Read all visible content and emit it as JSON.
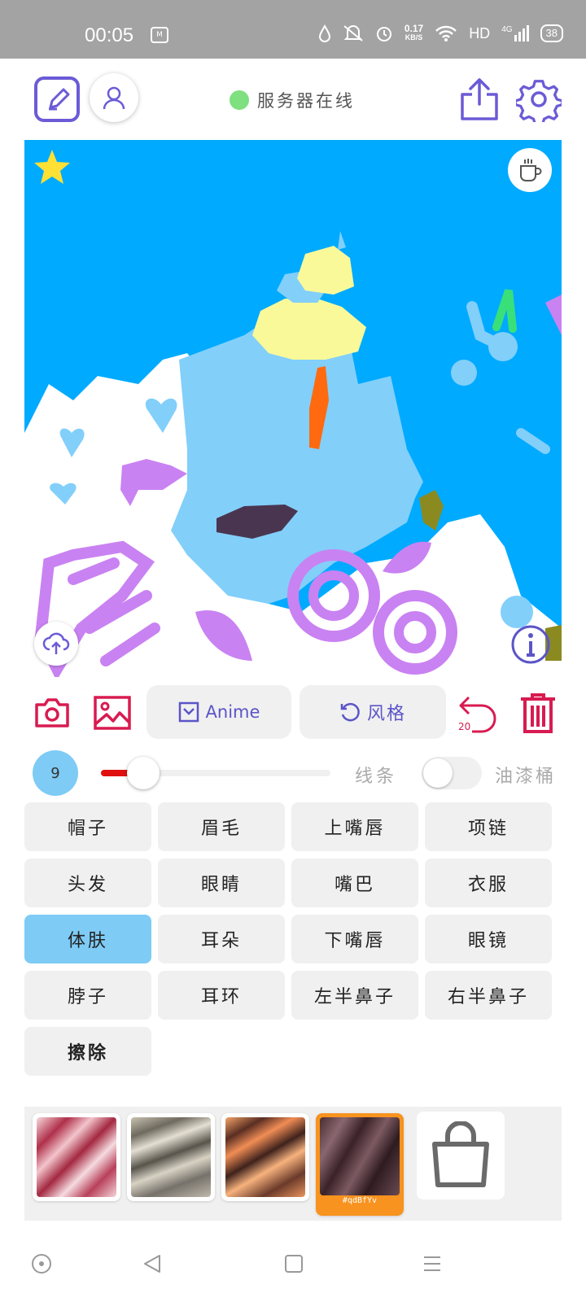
{
  "status_bar": {
    "time": "00:05",
    "nfc_label": "M",
    "net_speed_value": "0.17",
    "net_speed_unit": "KB/S",
    "network": "HD",
    "signal": "4G",
    "battery": "38"
  },
  "header": {
    "server_status": "服务器在线",
    "server_status_color": "#7ee07e"
  },
  "icons": {
    "edit": "pencil-square-icon",
    "user": "user-icon",
    "share": "share-icon",
    "settings": "gear-icon",
    "favorite": "star-icon",
    "coffee": "coffee-icon",
    "upload": "cloud-upload-icon",
    "info": "info-icon"
  },
  "toolbar": {
    "anime_label": "Anime",
    "style_label": "风格",
    "undo_count": "20"
  },
  "brush": {
    "size": "9",
    "size_fraction": 0.12,
    "line_label": "线条",
    "bucket_label": "油漆桶",
    "bucket_enabled": false
  },
  "parts": [
    {
      "label": "帽子"
    },
    {
      "label": "眉毛"
    },
    {
      "label": "上嘴唇"
    },
    {
      "label": "项链"
    },
    {
      "label": "头发"
    },
    {
      "label": "眼睛"
    },
    {
      "label": "嘴巴"
    },
    {
      "label": "衣服"
    },
    {
      "label": "体肤",
      "active": true
    },
    {
      "label": "耳朵"
    },
    {
      "label": "下嘴唇"
    },
    {
      "label": "眼镜"
    },
    {
      "label": "脖子"
    },
    {
      "label": "耳环"
    },
    {
      "label": "左半鼻子"
    },
    {
      "label": "右半鼻子"
    },
    {
      "label": "擦除",
      "bold": true
    }
  ],
  "styles": {
    "selected_caption": "#qdBfYv",
    "accent": "#f7931e"
  },
  "colors": {
    "accent_purple": "#5b55c8",
    "accent_red": "#d81b50",
    "canvas_bg": "#00aaff",
    "active_part": "#7ecbf5"
  }
}
